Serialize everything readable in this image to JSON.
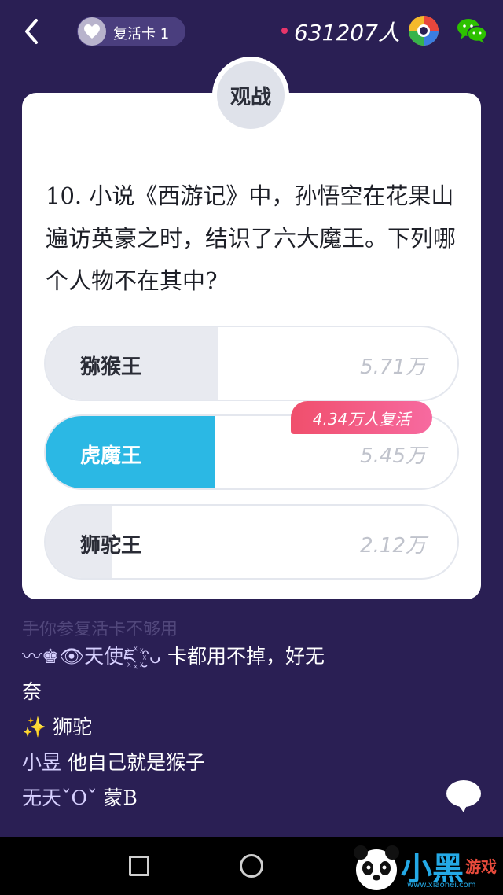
{
  "header": {
    "revive_card_label": "复活卡 1",
    "viewer_count": "631207人"
  },
  "card": {
    "watch_label": "观战",
    "question": "10. 小说《西游记》中，孙悟空在花果山遍访英豪之时，结识了六大魔王。下列哪个人物不在其中?",
    "options": [
      {
        "name": "猕猴王",
        "count": "5.71万",
        "share": 0.42,
        "selected": false
      },
      {
        "name": "虎魔王",
        "count": "5.45万",
        "share": 0.41,
        "selected": true
      },
      {
        "name": "狮驼王",
        "count": "2.12万",
        "share": 0.16,
        "selected": false
      }
    ],
    "revive_tag": "4.34万人复活"
  },
  "chat": {
    "faded_line": "手你参复活卡不够用",
    "messages": [
      {
        "nick": "〰♚👁天使ཇ꙰ ᵔ̮ᴗ",
        "text": "卡都用不掉，好无"
      },
      {
        "nick": "",
        "text": "奈"
      },
      {
        "nick": "✨",
        "text": "狮驼"
      },
      {
        "nick": "小昱",
        "text": "他自己就是猴子"
      },
      {
        "nick": "无天ˇOˇ",
        "text": "蒙B"
      }
    ]
  },
  "watermark": {
    "brand": "小黑",
    "brand2": "游戏",
    "url": "www.xiaohei.com"
  },
  "colors": {
    "background": "#2a1f54",
    "selected_fill": "#2bb8e4",
    "unselected_fill": "#e8eaf0",
    "revive_tag": "#f2557c"
  }
}
